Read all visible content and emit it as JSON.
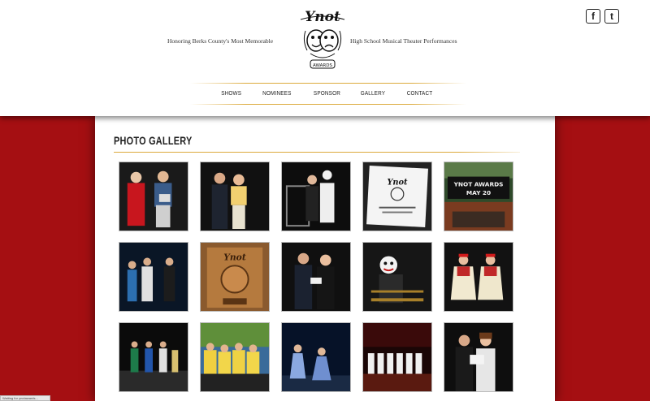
{
  "header": {
    "tagline_left": "Honoring Berks County's Most Memorable",
    "tagline_right": "High School Musical Theater Performances",
    "logo_text": "Ynot",
    "logo_subtext": "AWARDS"
  },
  "social": {
    "facebook_label": "f",
    "facebook_icon": "facebook-icon",
    "twitter_label": "t",
    "twitter_icon": "twitter-icon"
  },
  "nav": {
    "items": [
      {
        "label": "SHOWS"
      },
      {
        "label": "NOMINEES"
      },
      {
        "label": "SPONSOR"
      },
      {
        "label": "GALLERY"
      },
      {
        "label": "CONTACT"
      }
    ]
  },
  "main": {
    "title": "PHOTO GALLERY"
  },
  "gallery": {
    "photo_count": 15,
    "sign_text_1": "YNOT AWARDS",
    "sign_text_2": "MAY 20"
  },
  "colors": {
    "background_red": "#a50f12",
    "accent_gold": "#dcaa3c",
    "panel": "#ffffff"
  },
  "status": {
    "text": "Waiting for ynotawards..."
  }
}
